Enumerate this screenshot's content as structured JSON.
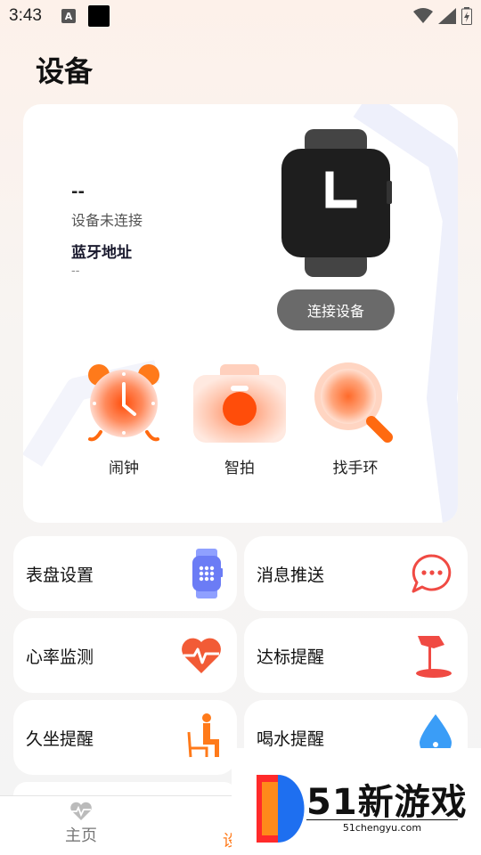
{
  "status_bar": {
    "time": "3:43",
    "a_icon": "A"
  },
  "page": {
    "title": "设备"
  },
  "device": {
    "name": "--",
    "status": "设备未连接",
    "bt_label": "蓝牙地址",
    "bt_value": "--",
    "connect_label": "连接设备"
  },
  "quick_actions": [
    {
      "label": "闹钟",
      "icon": "alarm-clock-icon"
    },
    {
      "label": "智拍",
      "icon": "camera-icon"
    },
    {
      "label": "找手环",
      "icon": "magnifier-icon"
    }
  ],
  "features": [
    {
      "label": "表盘设置",
      "icon": "watch-face-icon"
    },
    {
      "label": "消息推送",
      "icon": "chat-bubble-icon"
    },
    {
      "label": "心率监测",
      "icon": "heart-rate-icon"
    },
    {
      "label": "达标提醒",
      "icon": "flag-icon"
    },
    {
      "label": "久坐提醒",
      "icon": "sitting-person-icon"
    },
    {
      "label": "喝水提醒",
      "icon": "water-drop-icon"
    }
  ],
  "nav": {
    "home": "主页",
    "device_partial": "设"
  },
  "watermark": {
    "main": "51新游戏",
    "sub": "51chengyu.com"
  },
  "colors": {
    "accent": "#ff7a1a",
    "orange_icon": "#ff5a1f",
    "button_gray": "#6a6a6a",
    "watch_blue": "#6b7cf5",
    "red": "#f04a43"
  }
}
